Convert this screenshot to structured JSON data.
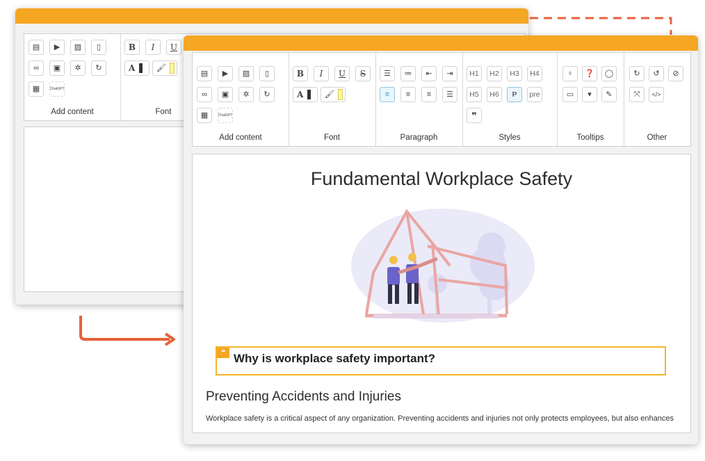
{
  "back_window": {
    "groups": [
      {
        "label": "Add content"
      },
      {
        "label": "Font"
      }
    ]
  },
  "front_window": {
    "toolbar": {
      "groups": [
        {
          "label": "Add content"
        },
        {
          "label": "Font"
        },
        {
          "label": "Paragraph"
        },
        {
          "label": "Styles"
        },
        {
          "label": "Tooltips"
        },
        {
          "label": "Other"
        }
      ],
      "style_buttons": [
        "H1",
        "H2",
        "H3",
        "H4",
        "H5",
        "H6",
        "P",
        "pre"
      ],
      "font_a": "A",
      "bold": "B",
      "italic": "I",
      "underline": "U",
      "strike": "S",
      "chatgpt_icon_text": "ChatGPT"
    },
    "content": {
      "title": "Fundamental Workplace Safety",
      "callout_icon": "❝",
      "callout_text": "Why is workplace safety important?",
      "heading": "Preventing Accidents and Injuries",
      "paragraph": "Workplace safety is a critical aspect of any organization. Preventing accidents and injuries not only protects employees, but also enhances"
    }
  },
  "colors": {
    "accent_bar": "#f5a623",
    "callout_border": "#f5b52a",
    "arrow": "#e8613a",
    "active_button": "#2a9ad6"
  }
}
